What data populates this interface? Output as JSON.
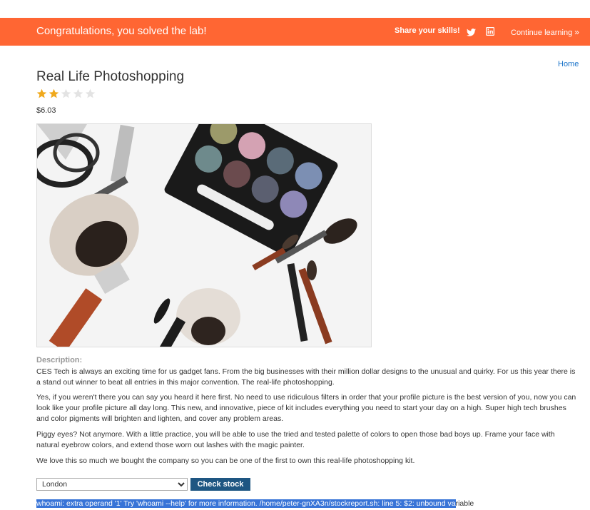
{
  "banner": {
    "title": "Congratulations, you solved the lab!",
    "share_label": "Share your skills!",
    "continue_label": "Continue learning",
    "bg_color": "#ff6633"
  },
  "nav": {
    "home_label": "Home"
  },
  "product": {
    "title": "Real Life Photoshopping",
    "rating": 2,
    "rating_max": 5,
    "price": "$6.03"
  },
  "description": {
    "label": "Description:",
    "paragraphs": [
      "CES Tech is always an exciting time for us gadget fans. From the big businesses with their million dollar designs to the unusual and quirky. For us this year there is a stand out winner to beat all entries in this major convention. The real-life photoshopping.",
      "Yes, if you weren't there you can say you heard it here first. No need to use ridiculous filters in order that your profile picture is the best version of you, now you can look like your profile picture all day long. This new, and innovative, piece of kit includes everything you need to start your day on a high. Super high tech brushes and color pigments will brighten and lighten, and cover any problem areas.",
      "Piggy eyes? Not anymore. With a little practice, you will be able to use the tried and tested palette of colors to open those bad boys up. Frame your face with natural eyebrow colors, and extend those worn out lashes with the magic painter.",
      "We love this so much we bought the company so you can be one of the first to own this real-life photoshopping kit."
    ]
  },
  "stock": {
    "selected_store": "London",
    "button_label": "Check stock",
    "output_selected": "whoami: extra operand '1' Try 'whoami --help' for more information. /home/peter-gnXA3n/stockreport.sh: line 5: $2: unbound va",
    "output_rest": "riable"
  }
}
